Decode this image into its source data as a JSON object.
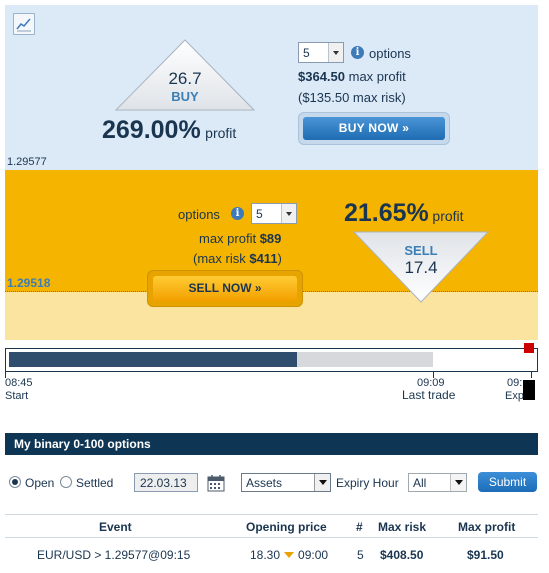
{
  "buy": {
    "price": "26.7",
    "label": "BUY",
    "profit_pct": "269.00%",
    "profit_word": "profit",
    "quantity": "5",
    "options_label": "options",
    "max_profit_value": "$364.50",
    "max_profit_label": "max profit",
    "max_risk_text": "($135.50 max risk)",
    "button": "BUY NOW »",
    "level": "1.29577"
  },
  "sell": {
    "price": "17.4",
    "label": "SELL",
    "profit_pct": "21.65%",
    "profit_word": "profit",
    "quantity": "5",
    "options_label": "options",
    "max_profit_label": "max profit",
    "max_profit_value": "$89",
    "max_risk_open": "(max risk ",
    "max_risk_value": "$411",
    "max_risk_close": ")",
    "button": "SELL NOW »",
    "level": "1.29518"
  },
  "timeline": {
    "progress": 0.68,
    "start_time": "08:45",
    "start_label": "Start",
    "last_trade_time": "09:09",
    "last_trade_label": "Last trade",
    "expiry_time": "09:",
    "expiry_label": "Exp"
  },
  "my_options": {
    "title": "My binary 0-100 options",
    "filter_open": "Open",
    "filter_settled": "Settled",
    "date": "22.03.13",
    "assets": "Assets",
    "expiry_hour_label": "Expiry Hour",
    "expiry_hour_value": "All",
    "submit": "Submit",
    "columns": [
      "Event",
      "Opening price",
      "#",
      "Max risk",
      "Max profit"
    ],
    "rows": [
      {
        "event": "EUR/USD > 1.29577@09:15",
        "opening_price": "18.30",
        "opening_time": "09:00",
        "count": "5",
        "max_risk": "$408.50",
        "max_profit": "$91.50"
      }
    ]
  },
  "colors": {
    "buy_bg": "#dce9f7",
    "sell_bg": "#f5b400",
    "navy": "#1a3550",
    "accent_blue": "#3b7fb6"
  }
}
